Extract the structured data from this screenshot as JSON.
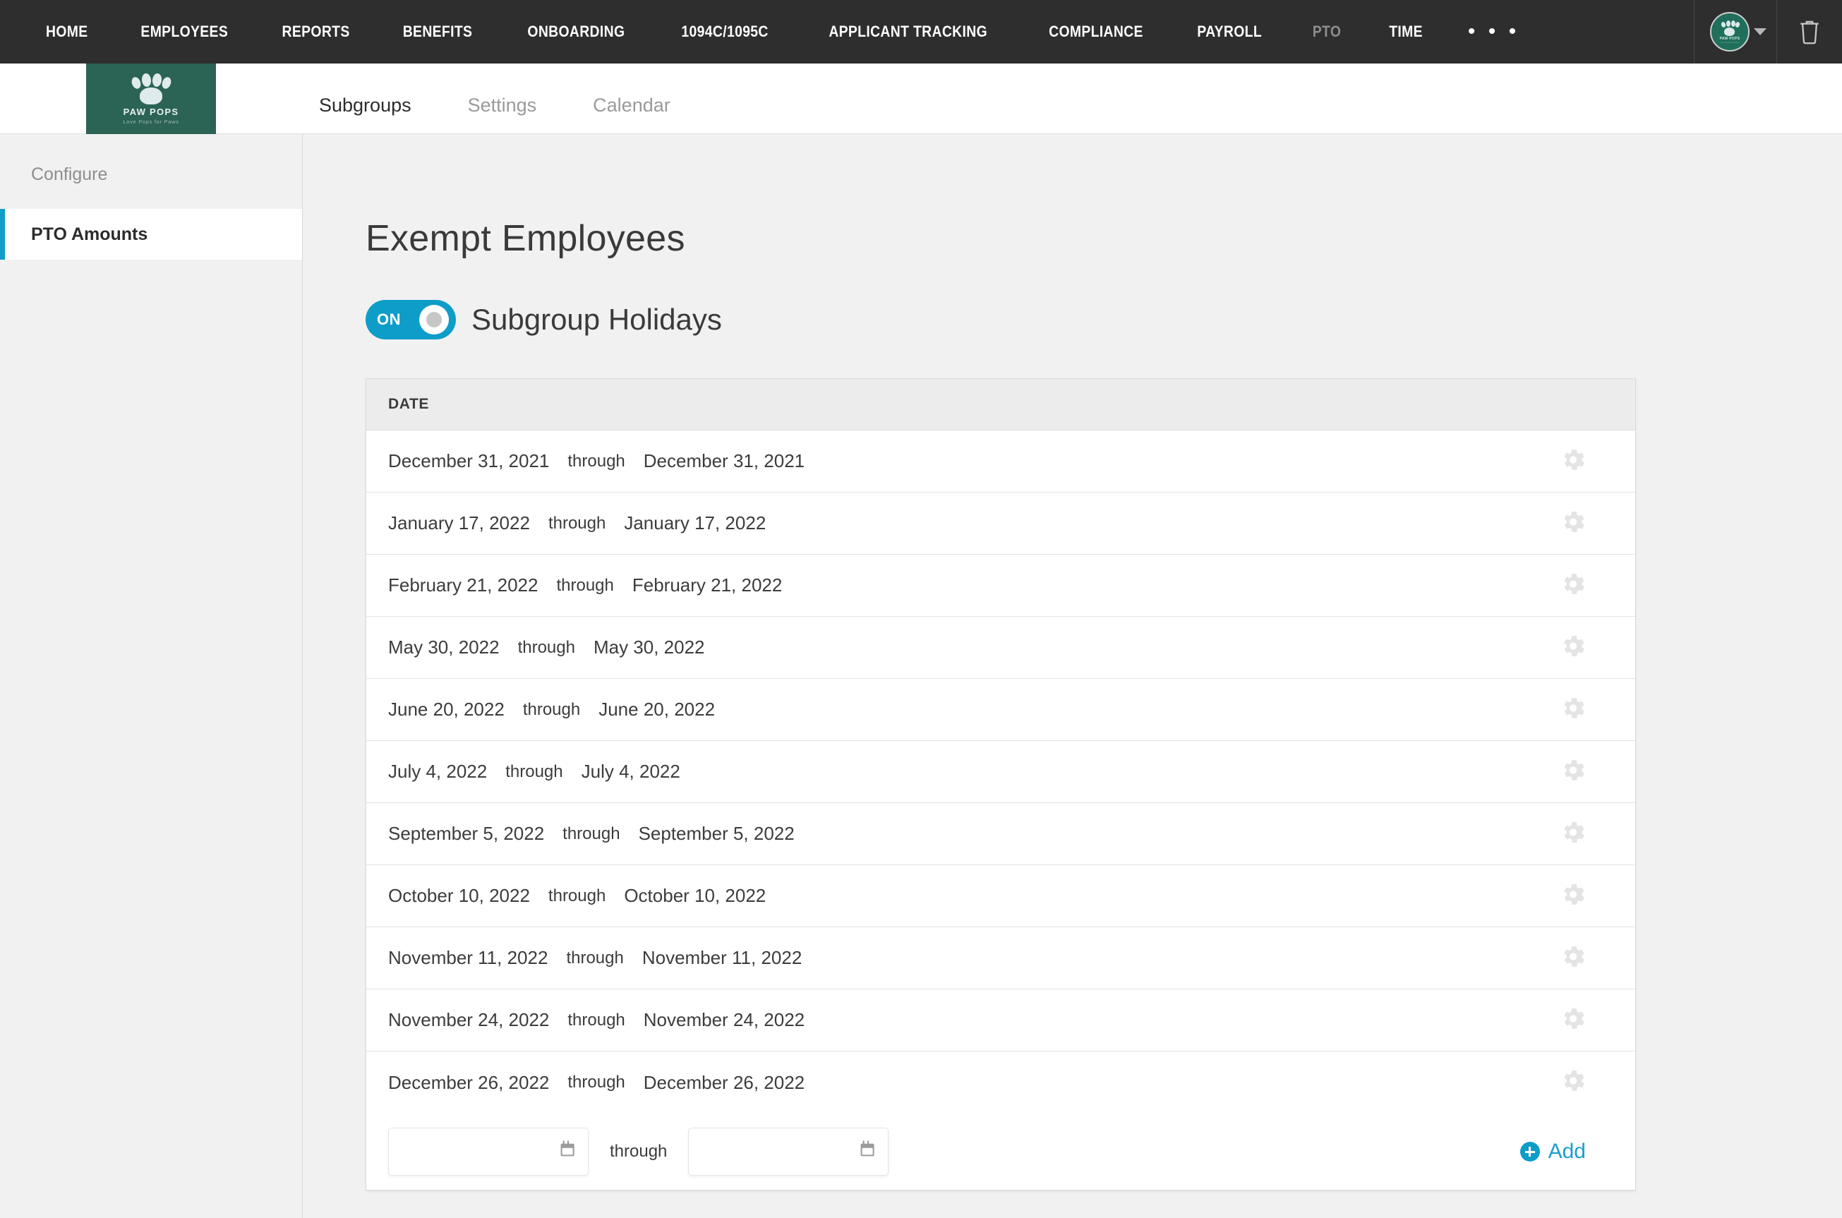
{
  "topnav": {
    "items": [
      {
        "label": "HOME",
        "state": "normal"
      },
      {
        "label": "EMPLOYEES",
        "state": "normal"
      },
      {
        "label": "REPORTS",
        "state": "normal"
      },
      {
        "label": "BENEFITS",
        "state": "normal"
      },
      {
        "label": "ONBOARDING",
        "state": "normal"
      },
      {
        "label": "1094C/1095C",
        "state": "normal"
      },
      {
        "label": "APPLICANT TRACKING",
        "state": "normal"
      },
      {
        "label": "COMPLIANCE",
        "state": "normal"
      },
      {
        "label": "PAYROLL",
        "state": "normal"
      },
      {
        "label": "PTO",
        "state": "dim"
      },
      {
        "label": "TIME",
        "state": "normal"
      }
    ],
    "overflow_label": "• • •",
    "avatar_icon": "paw-logo-avatar",
    "avatar_brand": "PAW POPS",
    "avatar_tagline": "Love Pops for Paws",
    "caret_icon": "chevron-down-icon",
    "trash_icon": "trash-icon",
    "background": "#2e2e2e"
  },
  "brandbar": {
    "logo_name": "PAW POPS",
    "logo_tagline": "Love Pops for Paws",
    "logo_background": "#2b6354",
    "tabs": [
      {
        "label": "Subgroups",
        "active": true
      },
      {
        "label": "Settings",
        "active": false
      },
      {
        "label": "Calendar",
        "active": false
      }
    ],
    "active_underline_color": "#0e9dc9"
  },
  "sidebar": {
    "header": "Configure",
    "items": [
      {
        "label": "PTO Amounts",
        "active": true
      }
    ],
    "active_marker_color": "#0e9dc9"
  },
  "main": {
    "page_title": "Exempt Employees",
    "toggle": {
      "state_label": "ON",
      "label": "Subgroup Holidays",
      "on_color": "#0e9dc9",
      "is_on": true
    },
    "table": {
      "column_header": "DATE",
      "through_label": "through",
      "row_action_icon": "gear-icon",
      "rows": [
        {
          "start": "December 31, 2021",
          "end": "December 31, 2021"
        },
        {
          "start": "January 17, 2022",
          "end": "January 17, 2022"
        },
        {
          "start": "February 21, 2022",
          "end": "February 21, 2022"
        },
        {
          "start": "May 30, 2022",
          "end": "May 30, 2022"
        },
        {
          "start": "June 20, 2022",
          "end": "June 20, 2022"
        },
        {
          "start": "July 4, 2022",
          "end": "July 4, 2022"
        },
        {
          "start": "September 5, 2022",
          "end": "September 5, 2022"
        },
        {
          "start": "October 10, 2022",
          "end": "October 10, 2022"
        },
        {
          "start": "November 11, 2022",
          "end": "November 11, 2022"
        },
        {
          "start": "November 24, 2022",
          "end": "November 24, 2022"
        },
        {
          "start": "December 26, 2022",
          "end": "December 26, 2022"
        }
      ],
      "add_row": {
        "start_value": "",
        "start_placeholder": "",
        "end_value": "",
        "end_placeholder": "",
        "through_label": "through",
        "calendar_icon": "calendar-icon",
        "add_label": "Add",
        "add_icon": "plus-circle-icon",
        "add_color": "#1b9ed1"
      }
    }
  }
}
